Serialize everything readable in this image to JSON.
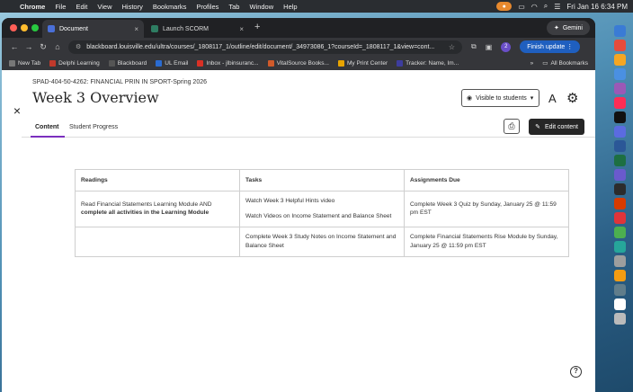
{
  "menubar": {
    "app": "Chrome",
    "items": [
      "File",
      "Edit",
      "View",
      "History",
      "Bookmarks",
      "Profiles",
      "Tab",
      "Window",
      "Help"
    ],
    "datetime": "Fri Jan 16  6:34 PM"
  },
  "browser": {
    "tabs": [
      {
        "label": "Document",
        "active": true,
        "color": "#4a6fd8"
      },
      {
        "label": "Launch SCORM",
        "active": false,
        "color": "#2e7d62"
      }
    ],
    "gemini_label": "Gemini",
    "url": "blackboard.louisville.edu/ultra/courses/_1808117_1/outline/edit/document/_34973086_1?courseId=_1808117_1&view=cont...",
    "finish_update": "Finish update",
    "profile_initial": "2",
    "bookmarks": [
      {
        "label": "New Tab",
        "color": "#777"
      },
      {
        "label": "Delphi Learning",
        "color": "#c0392b"
      },
      {
        "label": "Blackboard",
        "color": "#555"
      },
      {
        "label": "UL Email",
        "color": "#2a6bd1"
      },
      {
        "label": "Inbox - jlbinsuranc...",
        "color": "#d93025"
      },
      {
        "label": "VitalSource Books...",
        "color": "#d05a2a"
      },
      {
        "label": "My Print Center",
        "color": "#e8a400"
      },
      {
        "label": "Tracker: Name, Im...",
        "color": "#3d3d9e"
      }
    ],
    "all_bookmarks": "All Bookmarks"
  },
  "page": {
    "course_code": "SPAD-404-50-4262: FINANCIAL PRIN IN SPORT-Spring 2026",
    "title": "Week 3 Overview",
    "visibility": "Visible to students",
    "tabs": [
      "Content",
      "Student Progress"
    ],
    "edit_button": "Edit content"
  },
  "table": {
    "headers": [
      "Readings",
      "Tasks",
      "Assignments Due"
    ],
    "row1": {
      "reading_plain": "Read Financial Statements Learning Module AND",
      "reading_bold": "complete all activities in the Learning Module",
      "task1": "Watch Week 3 Helpful Hints video",
      "task2": "Watch Videos on Income Statement and Balance Sheet",
      "due": "Complete Week 3 Quiz by Sunday, January 25 @ 11:59 pm EST"
    },
    "row2": {
      "reading": "",
      "task": "Complete Week 3 Study Notes on Income Statement and Balance Sheet",
      "due": "Complete Financial Statements Rise Module by Sunday, January 25 @ 11:59 pm EST"
    }
  },
  "dock_colors": [
    "#3a7bd5",
    "#e74c3c",
    "#f5a623",
    "#4a90e2",
    "#9b59b6",
    "#ff2d55",
    "#111111",
    "#5b6be0",
    "#2b5797",
    "#1d6f42",
    "#6a5acd",
    "#2c2c2c",
    "#d83b01",
    "#e0343a",
    "#4caf50",
    "#26a69a",
    "#9e9e9e",
    "#f39c12",
    "#607d8b",
    "#ffffff",
    "#bbbbbb"
  ]
}
